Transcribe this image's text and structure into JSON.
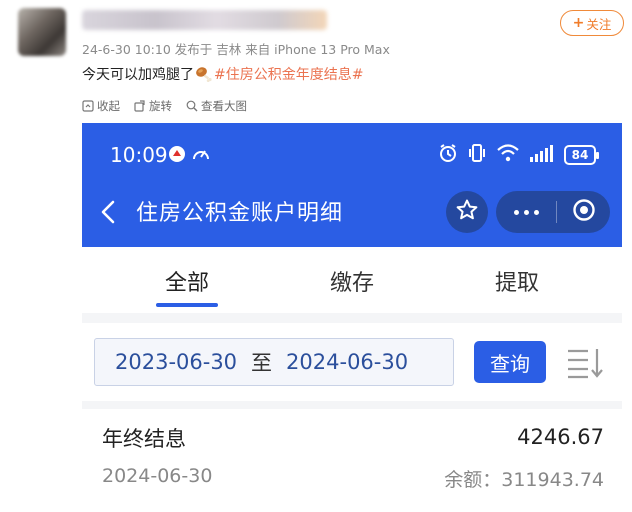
{
  "post": {
    "meta": "24-6-30 10:10 发布于 吉林 来自 iPhone 13 Pro Max",
    "follow_label": "关注",
    "text_main": "今天可以加鸡腿了",
    "hashtag": "#住房公积金年度结息#",
    "emoji": "drumstick-emoji",
    "toolbar": {
      "collapse": "收起",
      "rotate": "旋转",
      "view_large": "查看大图"
    }
  },
  "phone": {
    "status": {
      "time": "10:09",
      "battery": "84",
      "icons": [
        "vpn-icon",
        "speed-icon",
        "alarm-icon",
        "vibrate-icon",
        "wifi-icon",
        "signal-icon",
        "battery-icon"
      ]
    },
    "header": {
      "title": "住房公积金账户明细"
    },
    "tabs": [
      {
        "label": "全部",
        "active": true
      },
      {
        "label": "缴存",
        "active": false
      },
      {
        "label": "提取",
        "active": false
      }
    ],
    "filter": {
      "date_from": "2023-06-30",
      "separator": "至",
      "date_to": "2024-06-30",
      "query_label": "查询"
    },
    "record": {
      "title": "年终结息",
      "amount": "4246.67",
      "date": "2024-06-30",
      "balance": "余额：311943.74"
    }
  },
  "colors": {
    "accent_blue": "#2b5ee5",
    "capsule_blue": "#24489f",
    "follow_orange": "#f07c2a",
    "hashtag_orange": "#eb7350"
  }
}
